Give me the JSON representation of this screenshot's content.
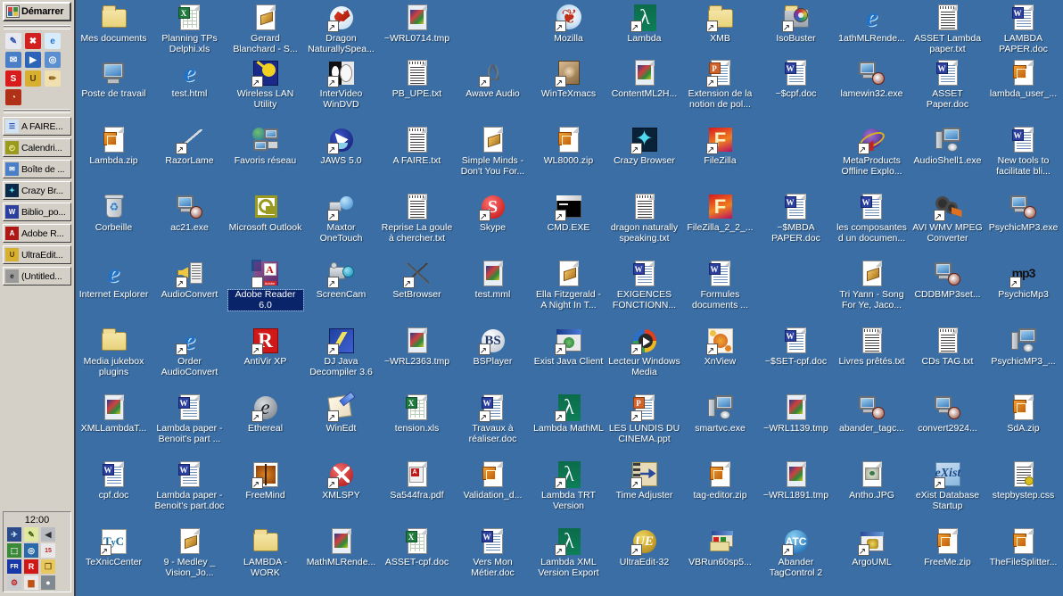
{
  "taskbar": {
    "start_label": "Démarrer",
    "clock": "12:00",
    "quick_launch": [
      {
        "name": "notes-icon",
        "glyph": "✎",
        "bg": "#e8e8f0",
        "fg": "#2b4ea8"
      },
      {
        "name": "close-red-icon",
        "glyph": "✖",
        "bg": "#d02020",
        "fg": "#ffffff"
      },
      {
        "name": "internet-explorer-icon",
        "glyph": "e",
        "bg": "#d8ecfb",
        "fg": "#1e73c8"
      },
      {
        "name": "outlook-express-icon",
        "glyph": "✉",
        "bg": "#4a7fc8",
        "fg": "#ffffff"
      },
      {
        "name": "media-player-icon",
        "glyph": "▶",
        "bg": "#2d64b8",
        "fg": "#ffffff"
      },
      {
        "name": "search-web-icon",
        "glyph": "◎",
        "bg": "#5c8fd0",
        "fg": "#ffffff"
      },
      {
        "name": "skype-icon",
        "glyph": "S",
        "bg": "#d81c1c",
        "fg": "#ffffff"
      },
      {
        "name": "ultraedit-icon",
        "glyph": "U",
        "bg": "#d8b030",
        "fg": "#5a3a00"
      },
      {
        "name": "winedt-icon",
        "glyph": "✏",
        "bg": "#f0e0b0",
        "fg": "#8a5a10"
      },
      {
        "name": "mozilla-icon",
        "glyph": "◔",
        "bg": "#b03018",
        "fg": "#ffe0b0"
      }
    ],
    "windows": [
      {
        "label": "A FAIRE...",
        "icon": "notepad-window-icon",
        "glyph": "☰",
        "bg": "#cfe3f5",
        "fg": "#2b4ea8"
      },
      {
        "label": "Calendri...",
        "icon": "calendar-window-icon",
        "glyph": "◴",
        "bg": "#9a9a20",
        "fg": "#ffffa0"
      },
      {
        "label": "Boîte de ...",
        "icon": "outlook-inbox-icon",
        "glyph": "✉",
        "bg": "#4a7fc8",
        "fg": "#ffffff"
      },
      {
        "label": "Crazy Br...",
        "icon": "crazy-browser-icon",
        "glyph": "✦",
        "bg": "#0a2a4a",
        "fg": "#60e0f0"
      },
      {
        "label": "Biblio_po...",
        "icon": "word-window-icon",
        "glyph": "W",
        "bg": "#2b3f9e",
        "fg": "#ffffff"
      },
      {
        "label": "Adobe R...",
        "icon": "adobe-reader-window-icon",
        "glyph": "A",
        "bg": "#b01818",
        "fg": "#ffffff"
      },
      {
        "label": "UltraEdit...",
        "icon": "ultraedit-window-icon",
        "glyph": "U",
        "bg": "#d8b030",
        "fg": "#5a3a00"
      },
      {
        "label": "(Untitled...",
        "icon": "ethereal-window-icon",
        "glyph": "e",
        "bg": "#9a9a9a",
        "fg": "#202020"
      }
    ],
    "tray_icons": [
      {
        "name": "jaws-icon",
        "glyph": "✈",
        "bg": "#2a4a8a",
        "fg": "#d0e8ff"
      },
      {
        "name": "notes-tray-icon",
        "glyph": "✎",
        "bg": "#e0e8a0",
        "fg": "#3a5a10"
      },
      {
        "name": "volume-icon",
        "glyph": "◀",
        "bg": "#b8bcc0",
        "fg": "#303030"
      },
      {
        "name": "network-icon",
        "glyph": "⬚",
        "bg": "#3a8a3a",
        "fg": "#ffffff"
      },
      {
        "name": "globe-tray-icon",
        "glyph": "◎",
        "bg": "#2a6aaa",
        "fg": "#ffffff"
      },
      {
        "name": "calendar-tray-icon",
        "glyph": "15",
        "bg": "#e8e8e8",
        "fg": "#c02020"
      },
      {
        "name": "language-fr-icon",
        "glyph": "FR",
        "bg": "#1838a8",
        "fg": "#ffffff"
      },
      {
        "name": "antivir-icon",
        "glyph": "R",
        "bg": "#d01818",
        "fg": "#ffffff"
      },
      {
        "name": "folder-share-icon",
        "glyph": "❐",
        "bg": "#e8c860",
        "fg": "#7a5a10"
      },
      {
        "name": "settings-tray-icon",
        "glyph": "⚙",
        "bg": "#c8ccd0",
        "fg": "#c02020"
      },
      {
        "name": "signal-icon",
        "glyph": "▆",
        "bg": "#e8e8e8",
        "fg": "#c05010"
      },
      {
        "name": "power-icon",
        "glyph": "●",
        "bg": "#808890",
        "fg": "#ffffff"
      }
    ]
  },
  "desktop": {
    "selected_icon": "Adobe Reader 6.0",
    "rows": [
      [
        {
          "label": "Mes documents",
          "type": "folder-docs",
          "shortcut": false
        },
        {
          "label": "Planning TPs Delphi.xls",
          "type": "xls",
          "shortcut": false
        },
        {
          "label": "Gerard Blanchard - S...",
          "type": "audio-doc",
          "shortcut": false
        },
        {
          "label": "Dragon NaturallySpea...",
          "type": "dragon",
          "shortcut": true
        },
        {
          "label": "~WRL0714.tmp",
          "type": "tmp",
          "shortcut": false
        },
        {
          "label": "",
          "type": "empty",
          "shortcut": false
        },
        {
          "label": "Mozilla",
          "type": "mozilla",
          "shortcut": true
        },
        {
          "label": "Lambda",
          "type": "lambda",
          "shortcut": true
        },
        {
          "label": "XMB",
          "type": "folder",
          "shortcut": true
        },
        {
          "label": "IsoBuster",
          "type": "isobuster",
          "shortcut": true
        },
        {
          "label": "1athMLRende...",
          "type": "ie",
          "shortcut": false
        },
        {
          "label": "ASSET Lambda paper.txt",
          "type": "txt",
          "shortcut": false
        },
        {
          "label": "LAMBDA PAPER.doc",
          "type": "doc",
          "shortcut": false
        }
      ],
      [
        {
          "label": "Poste de travail",
          "type": "computer",
          "shortcut": false
        },
        {
          "label": "test.html",
          "type": "ie",
          "shortcut": false
        },
        {
          "label": "Wireless LAN Utility",
          "type": "wireless",
          "shortcut": true
        },
        {
          "label": "InterVideo WinDVD",
          "type": "windvd",
          "shortcut": true
        },
        {
          "label": "PB_UPE.txt",
          "type": "txt",
          "shortcut": false
        },
        {
          "label": "Awave Audio",
          "type": "awave",
          "shortcut": true
        },
        {
          "label": "WinTeXmacs",
          "type": "texmacs",
          "shortcut": true
        },
        {
          "label": "ContentML2H...",
          "type": "tmp",
          "shortcut": false
        },
        {
          "label": "Extension de la notion de pol...",
          "type": "ppt",
          "shortcut": true
        },
        {
          "label": "~$cpf.doc",
          "type": "doc",
          "shortcut": false
        },
        {
          "label": "lamewin32.exe",
          "type": "exe-setup",
          "shortcut": false
        },
        {
          "label": "ASSET Paper.doc",
          "type": "doc",
          "shortcut": false
        },
        {
          "label": "lambda_user_...",
          "type": "zip",
          "shortcut": false
        }
      ],
      [
        {
          "label": "Lambda.zip",
          "type": "zip",
          "shortcut": false
        },
        {
          "label": "RazorLame",
          "type": "razorlame",
          "shortcut": true
        },
        {
          "label": "Favoris réseau",
          "type": "netplaces",
          "shortcut": false
        },
        {
          "label": "JAWS 5.0",
          "type": "jaws",
          "shortcut": true
        },
        {
          "label": "A FAIRE.txt",
          "type": "txt",
          "shortcut": false
        },
        {
          "label": "Simple Minds - Don't You For...",
          "type": "audio-doc",
          "shortcut": false
        },
        {
          "label": "WL8000.zip",
          "type": "zip",
          "shortcut": false
        },
        {
          "label": "Crazy Browser",
          "type": "crazybrowser",
          "shortcut": true
        },
        {
          "label": "FileZilla",
          "type": "filezilla",
          "shortcut": true
        },
        {
          "label": "",
          "type": "empty",
          "shortcut": false
        },
        {
          "label": "MetaProducts Offline Explo...",
          "type": "metaproducts",
          "shortcut": true
        },
        {
          "label": "AudioShell1.exe",
          "type": "exe-install",
          "shortcut": false
        },
        {
          "label": "New tools to facilitate bli...",
          "type": "doc",
          "shortcut": false
        }
      ],
      [
        {
          "label": "Corbeille",
          "type": "recyclebin",
          "shortcut": false
        },
        {
          "label": "ac21.exe",
          "type": "exe-setup",
          "shortcut": false
        },
        {
          "label": "Microsoft Outlook",
          "type": "outlook",
          "shortcut": false
        },
        {
          "label": "Maxtor OneTouch",
          "type": "maxtor",
          "shortcut": true
        },
        {
          "label": "Reprise La goule à chercher.txt",
          "type": "txt",
          "shortcut": false
        },
        {
          "label": "Skype",
          "type": "skype",
          "shortcut": true
        },
        {
          "label": "CMD.EXE",
          "type": "cmd",
          "shortcut": true
        },
        {
          "label": "dragon naturally speaking.txt",
          "type": "txt",
          "shortcut": false
        },
        {
          "label": "FileZilla_2_2_...",
          "type": "filezilla",
          "shortcut": false
        },
        {
          "label": "~$MBDA PAPER.doc",
          "type": "doc",
          "shortcut": false
        },
        {
          "label": "les composantes d un documen...",
          "type": "doc",
          "shortcut": false
        },
        {
          "label": "AVI WMV MPEG Converter",
          "type": "aviconv",
          "shortcut": true
        },
        {
          "label": "PsychicMP3.exe",
          "type": "exe-setup",
          "shortcut": false
        }
      ],
      [
        {
          "label": "Internet Explorer",
          "type": "ie",
          "shortcut": false
        },
        {
          "label": "AudioConvert",
          "type": "audioconvert",
          "shortcut": true
        },
        {
          "label": "Adobe Reader 6.0",
          "type": "adobe",
          "shortcut": true
        },
        {
          "label": "ScreenCam",
          "type": "screencam",
          "shortcut": true
        },
        {
          "label": "SetBrowser",
          "type": "tools",
          "shortcut": true
        },
        {
          "label": "test.mml",
          "type": "tmp",
          "shortcut": false
        },
        {
          "label": "Ella Fitzgerald - A Night In T...",
          "type": "audio-doc",
          "shortcut": false
        },
        {
          "label": "EXIGENCES FONCTIONN...",
          "type": "doc",
          "shortcut": false
        },
        {
          "label": "Formules documents ...",
          "type": "doc",
          "shortcut": false
        },
        {
          "label": "",
          "type": "empty",
          "shortcut": false
        },
        {
          "label": "Tri Yann - Song For Ye, Jaco...",
          "type": "audio-doc",
          "shortcut": false
        },
        {
          "label": "CDDBMP3set...",
          "type": "exe-setup",
          "shortcut": false
        },
        {
          "label": "PsychicMp3",
          "type": "mp3",
          "shortcut": true
        }
      ],
      [
        {
          "label": "Media jukebox plugins",
          "type": "folder",
          "shortcut": false
        },
        {
          "label": "Order AudioConvert",
          "type": "ie",
          "shortcut": true
        },
        {
          "label": "AntiVir XP",
          "type": "antivir",
          "shortcut": true
        },
        {
          "label": "DJ Java Decompiler 3.6",
          "type": "djjava",
          "shortcut": true
        },
        {
          "label": "~WRL2363.tmp",
          "type": "tmp",
          "shortcut": false
        },
        {
          "label": "BSPlayer",
          "type": "bsplayer",
          "shortcut": true
        },
        {
          "label": "Exist Java Client",
          "type": "javaclient",
          "shortcut": true
        },
        {
          "label": "Lecteur Windows Media",
          "type": "wmp",
          "shortcut": true
        },
        {
          "label": "XnView",
          "type": "xnview",
          "shortcut": true
        },
        {
          "label": "~$SET-cpf.doc",
          "type": "doc",
          "shortcut": false
        },
        {
          "label": "Livres prêtés.txt",
          "type": "txt",
          "shortcut": false
        },
        {
          "label": "CDs TAG.txt",
          "type": "txt",
          "shortcut": false
        },
        {
          "label": "PsychicMP3_...",
          "type": "exe-install",
          "shortcut": false
        }
      ],
      [
        {
          "label": "XMLLambdaT...",
          "type": "tmp",
          "shortcut": false
        },
        {
          "label": "Lambda paper - Benoit's part ...",
          "type": "doc",
          "shortcut": false
        },
        {
          "label": "Ethereal",
          "type": "ethereal",
          "shortcut": true
        },
        {
          "label": "WinEdt",
          "type": "winedt",
          "shortcut": true
        },
        {
          "label": "tension.xls",
          "type": "xls",
          "shortcut": false
        },
        {
          "label": "Travaux à réaliser.doc",
          "type": "doc",
          "shortcut": true
        },
        {
          "label": "Lambda MathML",
          "type": "lambda",
          "shortcut": true
        },
        {
          "label": "LES LUNDIS DU CINEMA.ppt",
          "type": "ppt",
          "shortcut": true
        },
        {
          "label": "smartvc.exe",
          "type": "exe-install",
          "shortcut": false
        },
        {
          "label": "~WRL1139.tmp",
          "type": "tmp",
          "shortcut": false
        },
        {
          "label": "abander_tagc...",
          "type": "exe-setup",
          "shortcut": false
        },
        {
          "label": "convert2924...",
          "type": "exe-setup",
          "shortcut": false
        },
        {
          "label": "SdA.zip",
          "type": "zip",
          "shortcut": false
        }
      ],
      [
        {
          "label": "cpf.doc",
          "type": "doc",
          "shortcut": false
        },
        {
          "label": "Lambda paper - Benoit's part.doc",
          "type": "doc",
          "shortcut": false
        },
        {
          "label": "FreeMind",
          "type": "freemind",
          "shortcut": true
        },
        {
          "label": "XMLSPY",
          "type": "xmlspy",
          "shortcut": true
        },
        {
          "label": "Sa544fra.pdf",
          "type": "pdf",
          "shortcut": false
        },
        {
          "label": "Validation_d...",
          "type": "zip",
          "shortcut": false
        },
        {
          "label": "Lambda TRT Version",
          "type": "lambda",
          "shortcut": true
        },
        {
          "label": "Time Adjuster",
          "type": "timeadjuster",
          "shortcut": true
        },
        {
          "label": "tag-editor.zip",
          "type": "zip",
          "shortcut": false
        },
        {
          "label": "~WRL1891.tmp",
          "type": "tmp",
          "shortcut": false
        },
        {
          "label": "Antho.JPG",
          "type": "jpg",
          "shortcut": false
        },
        {
          "label": "eXist Database Startup",
          "type": "exist",
          "shortcut": true
        },
        {
          "label": "stepbystep.css",
          "type": "css",
          "shortcut": false
        }
      ],
      [
        {
          "label": "TeXnicCenter",
          "type": "texnic",
          "shortcut": true
        },
        {
          "label": "9 - Medley _ Vision_Jo...",
          "type": "audio-doc",
          "shortcut": false
        },
        {
          "label": "LAMBDA - WORK",
          "type": "folder",
          "shortcut": false
        },
        {
          "label": "MathMLRende...",
          "type": "tmp",
          "shortcut": false
        },
        {
          "label": "ASSET-cpf.doc",
          "type": "xls",
          "shortcut": false
        },
        {
          "label": "Vers Mon Métier.doc",
          "type": "doc",
          "shortcut": false
        },
        {
          "label": "Lambda XML Version Export",
          "type": "lambda",
          "shortcut": true
        },
        {
          "label": "UltraEdit-32",
          "type": "ultraedit",
          "shortcut": true
        },
        {
          "label": "VBRun60sp5...",
          "type": "vbrun",
          "shortcut": false
        },
        {
          "label": "Abander TagControl 2",
          "type": "atc",
          "shortcut": true
        },
        {
          "label": "ArgoUML",
          "type": "argouml",
          "shortcut": true
        },
        {
          "label": "FreeMe.zip",
          "type": "zip",
          "shortcut": false
        },
        {
          "label": "TheFileSplitter...",
          "type": "zip",
          "shortcut": false
        }
      ]
    ]
  }
}
